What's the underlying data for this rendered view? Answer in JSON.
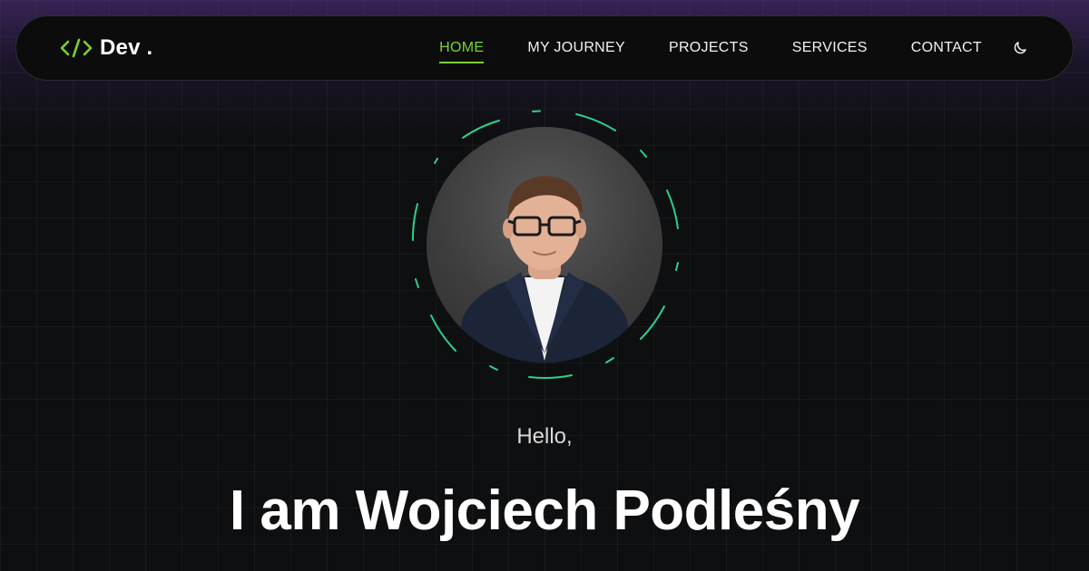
{
  "brand": {
    "logo_text": "Dev .",
    "logo_icon": "code-brackets-icon",
    "accent": "#7bd32a"
  },
  "nav": {
    "items": [
      {
        "label": "HOME",
        "active": true
      },
      {
        "label": "MY JOURNEY",
        "active": false
      },
      {
        "label": "PROJECTS",
        "active": false
      },
      {
        "label": "SERVICES",
        "active": false
      },
      {
        "label": "CONTACT",
        "active": false
      }
    ],
    "theme_toggle_icon": "moon-icon"
  },
  "hero": {
    "greeting": "Hello,",
    "headline": "I am Wojciech Podleśny",
    "avatar_icon": "profile-photo",
    "ring_color": "#2fd08a"
  }
}
